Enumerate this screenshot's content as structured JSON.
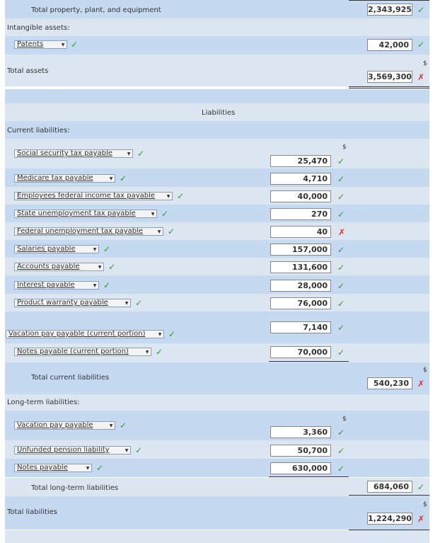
{
  "currency_symbol": "$",
  "assets": {
    "total_ppe": {
      "label": "Total property, plant, and equipment",
      "amount": "2,343,925",
      "status": "correct"
    },
    "intangible_header": "Intangible assets:",
    "patents": {
      "selection": "Patents",
      "amount": "42,000",
      "status": "correct"
    },
    "total_assets": {
      "label": "Total assets",
      "amount": "3,569,300",
      "status": "incorrect"
    }
  },
  "liabilities": {
    "section_title": "Liabilities",
    "current_header": "Current liabilities:",
    "current_items": [
      {
        "selection": "Social security tax payable",
        "amount": "25,470",
        "status": "correct"
      },
      {
        "selection": "Medicare tax payable",
        "amount": "4,710",
        "status": "correct"
      },
      {
        "selection": "Employees federal income tax payable",
        "amount": "40,000",
        "status": "correct"
      },
      {
        "selection": "State unemployment tax payable",
        "amount": "270",
        "status": "correct"
      },
      {
        "selection": "Federal unemployment tax payable",
        "amount": "40",
        "status": "incorrect"
      },
      {
        "selection": "Salaries payable",
        "amount": "157,000",
        "status": "correct"
      },
      {
        "selection": "Accounts payable",
        "amount": "131,600",
        "status": "correct"
      },
      {
        "selection": "Interest payable",
        "amount": "28,000",
        "status": "correct"
      },
      {
        "selection": "Product warranty payable",
        "amount": "76,000",
        "status": "correct"
      },
      {
        "selection": "Vacation pay payable (current portion)",
        "amount": "7,140",
        "status": "correct"
      },
      {
        "selection": "Notes payable (current portion)",
        "amount": "70,000",
        "status": "correct"
      }
    ],
    "total_current": {
      "label": "Total current liabilities",
      "amount": "540,230",
      "status": "incorrect"
    },
    "longterm_header": "Long-term liabilities:",
    "longterm_items": [
      {
        "selection": "Vacation pay payable",
        "amount": "3,360",
        "status": "correct"
      },
      {
        "selection": "Unfunded pension liability",
        "amount": "50,700",
        "status": "correct"
      },
      {
        "selection": "Notes payable",
        "amount": "630,000",
        "status": "correct"
      }
    ],
    "total_longterm": {
      "label": "Total long-term liabilities",
      "amount": "684,060",
      "status": "correct"
    },
    "total_liabilities": {
      "label": "Total liabilities",
      "amount": "1,224,290",
      "status": "incorrect"
    }
  },
  "icons": {
    "correct": "check-icon",
    "incorrect": "x-icon"
  },
  "colors": {
    "row_light": "#dce6f1",
    "row_dark": "#c5d9f1",
    "correct": "#2e9a2e",
    "incorrect": "#e03030"
  }
}
